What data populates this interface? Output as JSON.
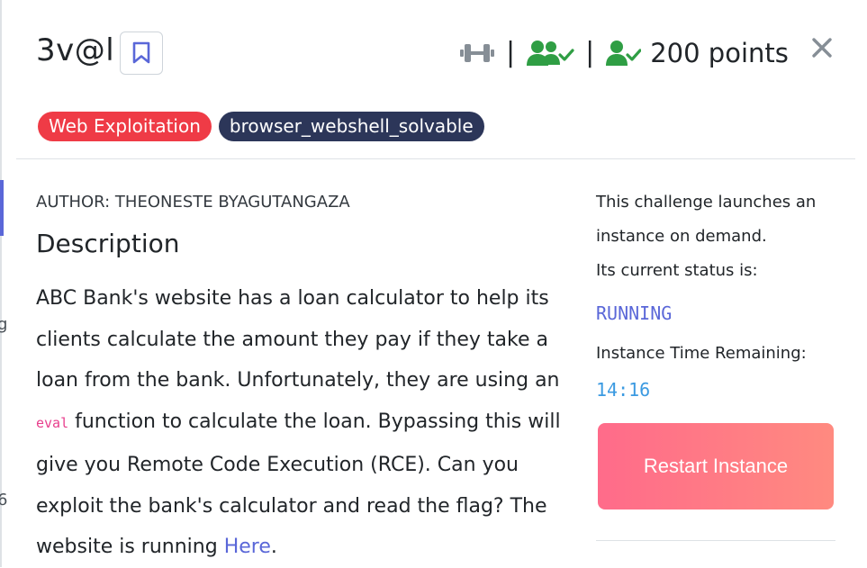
{
  "challenge": {
    "title": "3v@l",
    "points": "200 points",
    "tags": [
      "Web Exploitation",
      "browser_webshell_solvable"
    ]
  },
  "description": {
    "author": "AUTHOR: THEONESTE BYAGUTANGAZA",
    "heading": "Description",
    "text_1": "ABC Bank's website has a loan calculator to help its clients calculate the amount they pay if they take a loan from the bank. Unfortunately, they are using an ",
    "code": "eval",
    "text_2": " function to calculate the loan. Bypassing this will give you Remote Code Execution (RCE). Can you exploit the bank's calculator and read the flag? The website is running ",
    "link_label": "Here",
    "text_3": "."
  },
  "instance": {
    "line_1": "This challenge launches an",
    "line_2": "instance on demand.",
    "line_3": "Its current status is:",
    "status": "RUNNING",
    "time_label": "Instance Time Remaining:",
    "time": "14:16",
    "restart_label": "Restart Instance"
  },
  "colors": {
    "accent": "#5a67d8",
    "success_green": "#2f9e44",
    "tag_red": "#ef3b46",
    "tag_dark": "#2c3659",
    "timer_blue": "#3b9ae1"
  },
  "icons": {
    "bookmark": "bookmark-icon",
    "difficulty": "dumbbell-icon",
    "solves": "users-check-icon",
    "solved": "user-check-icon",
    "close": "close-icon"
  }
}
